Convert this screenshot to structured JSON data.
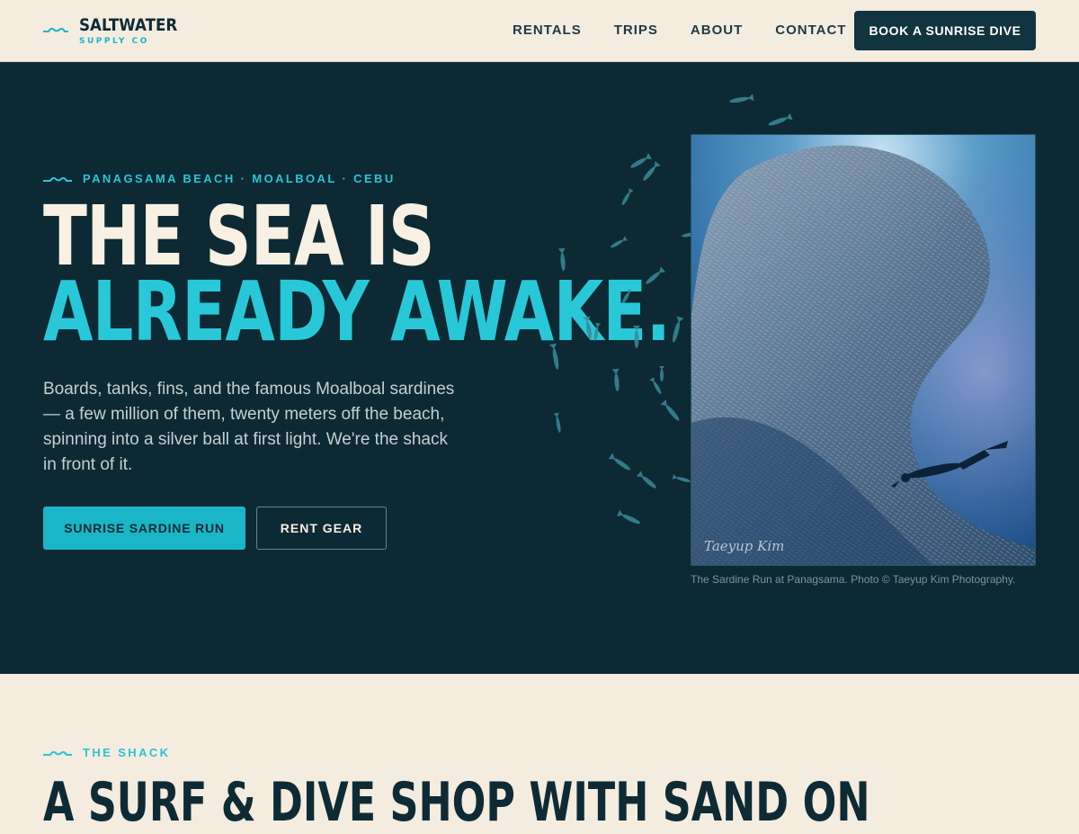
{
  "brand": {
    "name": "SALTWATER",
    "tagline": "SUPPLY CO",
    "icon": "wave-icon"
  },
  "nav": {
    "items": [
      "RENTALS",
      "TRIPS",
      "ABOUT",
      "CONTACT"
    ],
    "cta": "BOOK A SUNRISE DIVE"
  },
  "hero": {
    "eyebrow": "PANAGSAMA BEACH · MOALBOAL · CEBU",
    "headline_line1": "THE SEA IS",
    "headline_line2": "ALREADY AWAKE.",
    "intro": "Boards, tanks, fins, and the famous Moalboal sardines — a few million of them, twenty meters off the beach, spinning into a silver ball at first light. We're the shack in front of it.",
    "primary_button": "SUNRISE SARDINE RUN",
    "secondary_button": "RENT GEAR",
    "photo_caption": "The Sardine Run at Panagsama. Photo © Taeyup Kim Photography.",
    "photo_signature": "Taeyup Kim"
  },
  "shack": {
    "eyebrow": "THE SHACK",
    "title": "A SURF & DIVE SHOP WITH SAND ON"
  },
  "colors": {
    "sand": "#f4ecdf",
    "deep_sea": "#0d2a34",
    "turquoise": "#28c8d8",
    "ink": "#0e2b35"
  }
}
